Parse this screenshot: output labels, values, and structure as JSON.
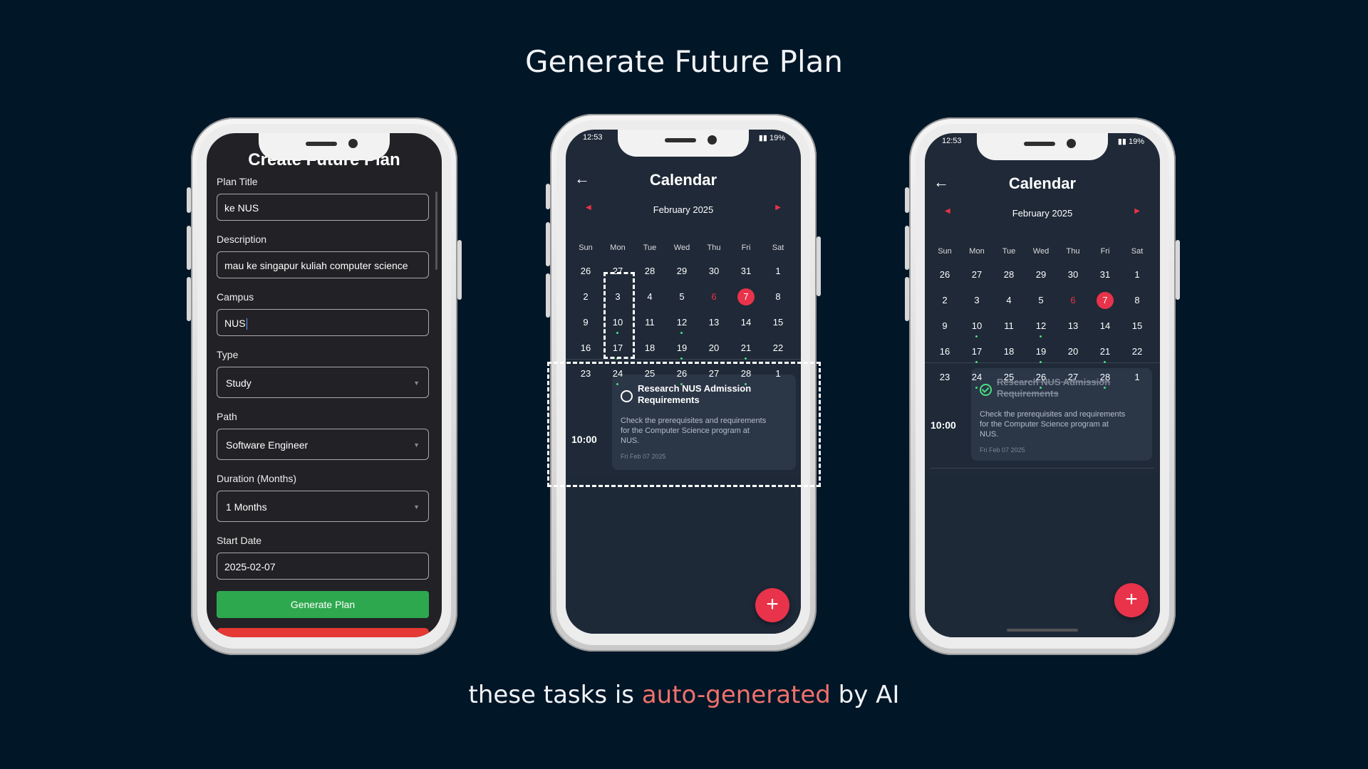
{
  "slide": {
    "title": "Generate Future Plan",
    "caption_pre": "these tasks is ",
    "caption_highlight": "auto-generated",
    "caption_post": " by AI",
    "highlight_color": "#f0716c"
  },
  "form": {
    "title": "Create Future Plan",
    "plan_title_label": "Plan Title",
    "plan_title_value": "ke NUS",
    "description_label": "Description",
    "description_value": "mau ke singapur kuliah computer science",
    "campus_label": "Campus",
    "campus_value": "NUS",
    "type_label": "Type",
    "type_value": "Study",
    "path_label": "Path",
    "path_value": "Software Engineer",
    "duration_label": "Duration (Months)",
    "duration_value": "1 Months",
    "start_date_label": "Start Date",
    "start_date_value": "2025-02-07",
    "generate_label": "Generate Plan",
    "generate_color": "#2ea84e"
  },
  "calendar": {
    "title": "Calendar",
    "month": "February 2025",
    "status_time": "12:53",
    "status_battery": "19%",
    "weekdays": [
      "Sun",
      "Mon",
      "Tue",
      "Wed",
      "Thu",
      "Fri",
      "Sat"
    ],
    "weeks": [
      [
        "26",
        "27",
        "28",
        "29",
        "30",
        "31",
        "1"
      ],
      [
        "2",
        "3",
        "4",
        "5",
        "6",
        "7",
        "8"
      ],
      [
        "9",
        "10",
        "11",
        "12",
        "13",
        "14",
        "15"
      ],
      [
        "16",
        "17",
        "18",
        "19",
        "20",
        "21",
        "22"
      ],
      [
        "23",
        "24",
        "25",
        "26",
        "27",
        "28",
        "1"
      ]
    ],
    "today": "6",
    "selected": "7",
    "event_days": [
      "10",
      "12",
      "17",
      "19",
      "21",
      "24",
      "26",
      "28"
    ],
    "accent": "#e8334a",
    "task": {
      "time": "10:00",
      "title": "Research NUS Admission Requirements",
      "description": "Check the prerequisites and requirements for the Computer Science program at NUS.",
      "date": "Fri Feb 07 2025"
    },
    "fab_label": "+"
  }
}
